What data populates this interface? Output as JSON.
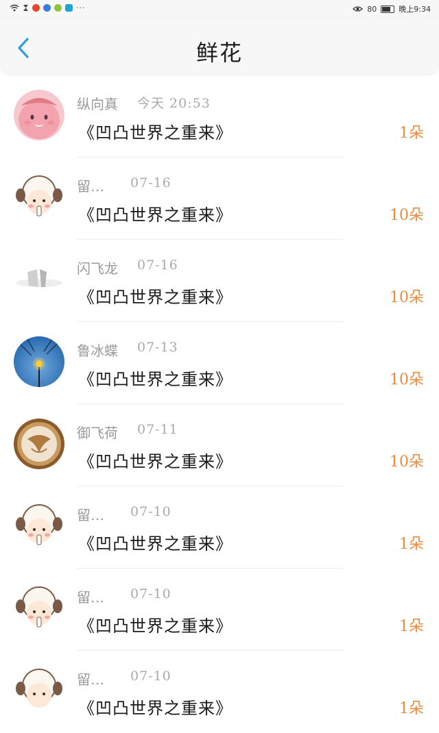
{
  "status_bar": {
    "battery": "80",
    "time": "晚上9:34",
    "notification_icons": [
      "wifi-icon",
      "hourglass-icon",
      "weibo-icon",
      "music-icon",
      "chat-icon",
      "app-icon"
    ],
    "more": "···"
  },
  "header": {
    "title": "鲜花",
    "back_icon": "chevron-left-icon",
    "accent": "#2f9be0"
  },
  "items": [
    {
      "user": "纵向真",
      "time": "今天 20:53",
      "book": "《凹凸世界之重来》",
      "count": "1朵",
      "avatar": "pink-face"
    },
    {
      "user": "留…",
      "time": "07-16",
      "book": "《凹凸世界之重来》",
      "count": "10朵",
      "avatar": "sheep"
    },
    {
      "user": "闪飞龙",
      "time": "07-16",
      "book": "《凹凸世界之重来》",
      "count": "10朵",
      "avatar": "white-blur"
    },
    {
      "user": "鲁冰蝶",
      "time": "07-13",
      "book": "《凹凸世界之重来》",
      "count": "10朵",
      "avatar": "street-lamp"
    },
    {
      "user": "御飞荷",
      "time": "07-11",
      "book": "《凹凸世界之重来》",
      "count": "10朵",
      "avatar": "latte-art"
    },
    {
      "user": "留…",
      "time": "07-10",
      "book": "《凹凸世界之重来》",
      "count": "1朵",
      "avatar": "sheep"
    },
    {
      "user": "留…",
      "time": "07-10",
      "book": "《凹凸世界之重来》",
      "count": "1朵",
      "avatar": "sheep"
    },
    {
      "user": "留…",
      "time": "07-10",
      "book": "《凹凸世界之重来》",
      "count": "1朵",
      "avatar": "sheep"
    }
  ],
  "colors": {
    "count": "#e98a3e",
    "secondary_text": "#9a9a9a",
    "primary_text": "#1a1a1a"
  }
}
